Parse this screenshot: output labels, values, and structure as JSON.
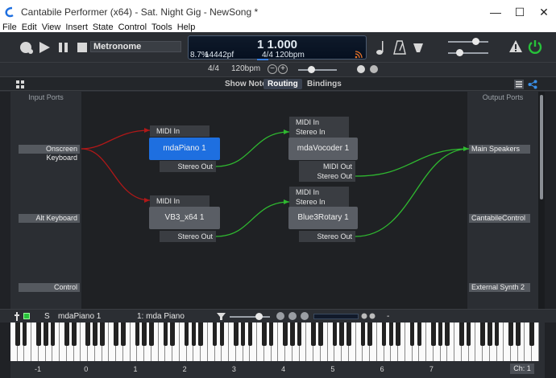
{
  "window": {
    "title": "Cantabile Performer (x64) - Sat. Night Gig - NewSong *",
    "controls": [
      "—",
      "☐",
      "✕"
    ]
  },
  "menu": [
    "File",
    "Edit",
    "View",
    "Insert",
    "State",
    "Control",
    "Tools",
    "Help"
  ],
  "transport": {
    "metronome_label": "Metronome",
    "position": "1 1.000",
    "cpu_load": "8.7%",
    "samples": "14442pf",
    "timesig_tempo": "4/4 120bpm",
    "timesig": "4/4",
    "tempo": "120bpm",
    "minus": "−",
    "plus": "+",
    "progress": 0.25
  },
  "tabs": {
    "show_notes": "Show Notes",
    "routing": "Routing",
    "bindings": "Bindings"
  },
  "ports": {
    "input_header": "Input Ports",
    "output_header": "Output Ports",
    "inputs": [
      "Onscreen Keyboard",
      "Alt Keyboard",
      "Control"
    ],
    "outputs": [
      "Main Speakers",
      "CantabileControl",
      "External Synth 2"
    ]
  },
  "plugins": [
    {
      "name": "mdaPiano 1",
      "in": "MIDI In",
      "out": "Stereo Out",
      "selected": true
    },
    {
      "name": "mdaVocoder 1",
      "in1": "MIDI In",
      "in2": "Stereo In",
      "out1": "MIDI Out",
      "out2": "Stereo Out",
      "selected": false
    },
    {
      "name": "VB3_x64 1",
      "in": "MIDI In",
      "out": "Stereo Out",
      "selected": false
    },
    {
      "name": "Blue3Rotary 1",
      "in1": "MIDI In",
      "in2": "Stereo In",
      "out": "Stereo Out",
      "selected": false
    }
  ],
  "instrument_strip": {
    "s_label": "S",
    "instrument": "mdaPiano 1",
    "program": "1: mda Piano",
    "dash": "-"
  },
  "keyboard": {
    "octave_labels": [
      "-1",
      "0",
      "1",
      "2",
      "3",
      "4",
      "5",
      "6",
      "7"
    ],
    "channel": "Ch: 1"
  },
  "colors": {
    "accent": "#1e6fe0",
    "wire_red": "#b01818",
    "wire_green": "#2fb830",
    "power_green": "#27c23a"
  }
}
